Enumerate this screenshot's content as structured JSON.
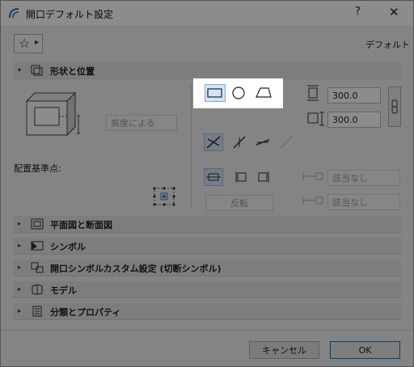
{
  "window": {
    "title": "開口デフォルト設定",
    "help": "?",
    "close": "✕"
  },
  "toolbar": {
    "favorites_label": "☆",
    "favorites_arrow": "▸",
    "default_label": "デフォルト"
  },
  "sections": {
    "shape": {
      "label": "形状と位置",
      "arrow": "▾"
    },
    "plan": {
      "label": "平面図と断面図",
      "arrow": "▸"
    },
    "symbol": {
      "label": "シンボル",
      "arrow": "▸"
    },
    "custom": {
      "label": "開口シンボルカスタム設定 (切断シンボル)",
      "arrow": "▸"
    },
    "model": {
      "label": "モデル",
      "arrow": "▸"
    },
    "classification": {
      "label": "分類とプロパティ",
      "arrow": "▸"
    }
  },
  "shape_panel": {
    "height_by": "高度による",
    "anchor_label": "配置基準点:",
    "width_value": "300.0",
    "height_value": "300.0",
    "flip_label": "反転",
    "applies1": "該当なし",
    "applies2": "該当なし"
  },
  "buttons": {
    "cancel": "キャンセル",
    "ok": "OK"
  },
  "colors": {
    "accent": "#0078d7",
    "overlay": "rgba(0,0,0,0.45)",
    "active": "#d4e4f7"
  }
}
